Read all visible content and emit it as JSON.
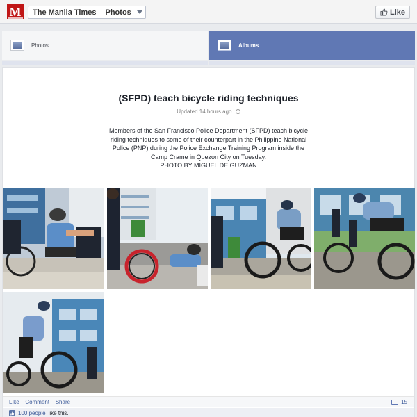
{
  "header": {
    "logo_letter": "M",
    "page_name": "The Manila Times",
    "section_name": "Photos",
    "like_label": "Like",
    "icons": {
      "logo": "manila-times-logo",
      "caret": "chevron-down-icon",
      "like": "thumbs-up-icon"
    }
  },
  "tabs": [
    {
      "label": "Photos",
      "active": false,
      "icon": "photos-icon"
    },
    {
      "label": "Albums",
      "active": true,
      "icon": "albums-icon"
    }
  ],
  "album": {
    "title": "(SFPD) teach bicycle riding techniques",
    "updated": "Updated 14 hours ago",
    "description": "Members of the San Francisco Police Department (SFPD) teach bicycle riding techniques to some of their counterpart in the Philippine National Police (PNP) during the Police Exchange Training Program inside the Camp Crame in Quezon City on Tuesday.\nPHOTO BY MIGUEL DE GUZMAN",
    "photo_count": 5
  },
  "footer": {
    "like": "Like",
    "comment": "Comment",
    "share": "Share",
    "comment_count": "15",
    "likes_link": "100 people",
    "likes_suffix": "like this."
  },
  "colors": {
    "accent": "#3b5998",
    "active_tab": "#6078b4",
    "logo_red": "#c01616"
  }
}
